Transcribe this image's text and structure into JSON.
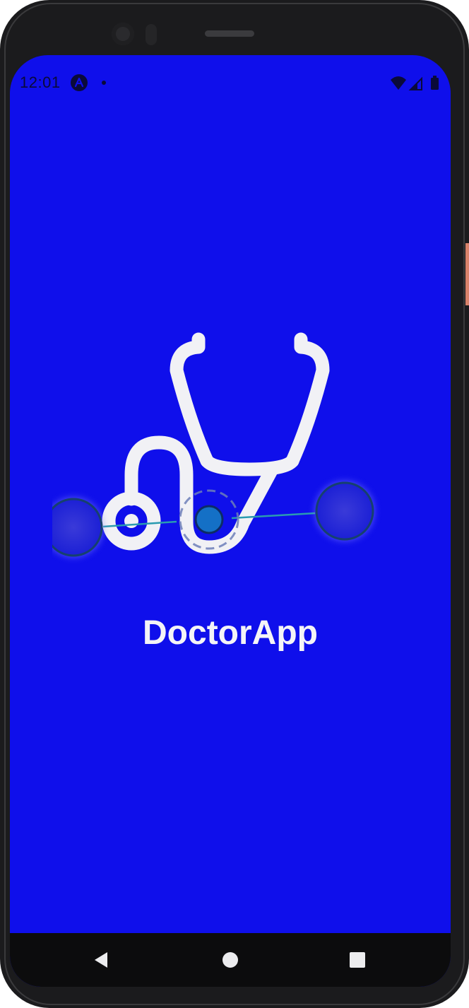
{
  "status_bar": {
    "time": "12:01",
    "icons": [
      "a-launcher-icon",
      "notification-dot-icon",
      "wifi-icon",
      "signal-icon",
      "battery-icon"
    ]
  },
  "splash": {
    "logo": "stethoscope-icon",
    "title": "DoctorApp"
  },
  "navigation": {
    "buttons": [
      "back-icon",
      "home-icon",
      "recents-icon"
    ]
  },
  "colors": {
    "background": "#0f0feb",
    "logo": "#f1f1f5",
    "title": "#f4f4f7",
    "nav_bar": "#0c0c0d"
  }
}
